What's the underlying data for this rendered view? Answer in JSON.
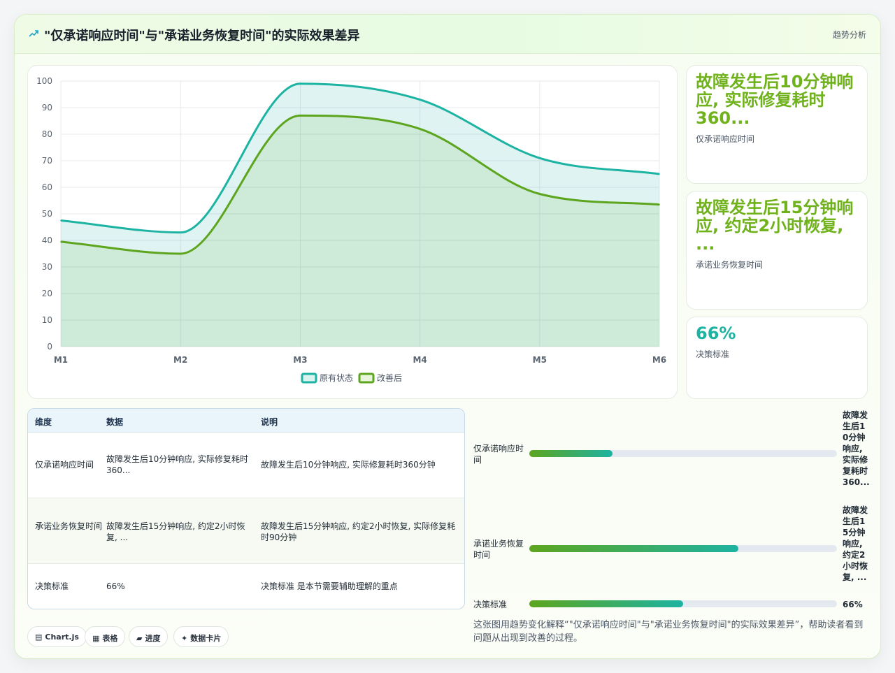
{
  "header": {
    "title": "\"仅承诺响应时间\"与\"承诺业务恢复时间\"的实际效果差异",
    "tag": "趋势分析"
  },
  "chart_data": {
    "type": "area",
    "categories": [
      "M1",
      "M2",
      "M3",
      "M4",
      "M5",
      "M6"
    ],
    "series": [
      {
        "name": "原有状态",
        "values": [
          47.5,
          43,
          99,
          93,
          71,
          65
        ],
        "color": "#1db3a2"
      },
      {
        "name": "改善后",
        "values": [
          39.5,
          35,
          87,
          82,
          57.5,
          53.5
        ],
        "color": "#5da51e"
      }
    ],
    "ylim": [
      0,
      100
    ],
    "yticks": [
      0,
      10,
      20,
      30,
      40,
      50,
      60,
      70,
      80,
      90,
      100
    ],
    "grid": true,
    "legend": "bottom"
  },
  "kpis": [
    {
      "value": "故障发生后10分钟响应, 实际修复耗时360...",
      "label": "仅承诺响应时间"
    },
    {
      "value": "故障发生后15分钟响应, 约定2小时恢复, ...",
      "label": "承诺业务恢复时间"
    },
    {
      "value": "66%",
      "label": "决策标准"
    }
  ],
  "table": {
    "headers": [
      "维度",
      "数据",
      "说明"
    ],
    "rows": [
      {
        "dim": "仅承诺响应时间",
        "data": "故障发生后10分钟响应, 实际修复耗时360...",
        "note": "故障发生后10分钟响应, 实际修复耗时360分钟"
      },
      {
        "dim": "承诺业务恢复时间",
        "data": "故障发生后15分钟响应, 约定2小时恢复, ...",
        "note": "故障发生后15分钟响应, 约定2小时恢复, 实际修复耗时90分钟"
      },
      {
        "dim": "决策标准",
        "data": "66%",
        "note": "决策标准 是本节需要辅助理解的重点"
      }
    ]
  },
  "progress": [
    {
      "label": "仅承诺响应时间",
      "value": "故障发生后10分钟响应, 实际修复耗时360...",
      "fraction": 0.27
    },
    {
      "label": "承诺业务恢复时间",
      "value": "故障发生后15分钟响应, 约定2小时恢复, ...",
      "fraction": 0.68
    },
    {
      "label": "决策标准",
      "value": "66%",
      "fraction": 0.5
    }
  ],
  "chips": [
    {
      "icon": "▤",
      "label": "Chart.js"
    },
    {
      "icon": "▦",
      "label": "表格"
    },
    {
      "icon": "▰",
      "label": "进度"
    },
    {
      "icon": "✦",
      "label": "数据卡片"
    }
  ],
  "description": "这张图用趋势变化解释“\"仅承诺响应时间\"与\"承诺业务恢复时间\"的实际效果差异”，帮助读者看到问题从出现到改善的过程。"
}
